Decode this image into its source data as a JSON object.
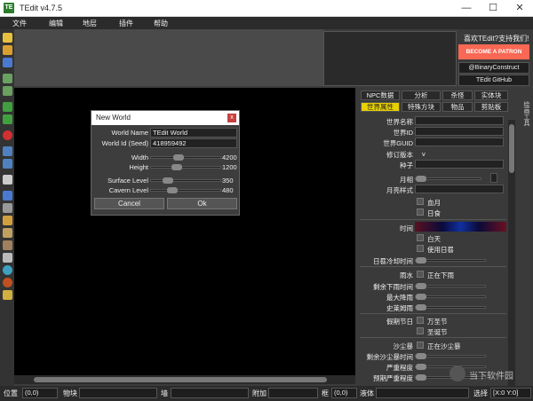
{
  "window": {
    "title": "TEdit v4.7.5",
    "app_icon": "TE",
    "minimize": "—",
    "maximize": "☐",
    "close": "✕"
  },
  "menu": [
    "文件",
    "编辑",
    "地层",
    "插件",
    "帮助"
  ],
  "support": {
    "label": "喜欢TEdit?支持我们!",
    "patron": "BECOME A PATRON",
    "twitter": "@BinaryConstruct",
    "github": "TEdit GitHub"
  },
  "dialog": {
    "title": "New World",
    "close": "x",
    "world_name_label": "World Name",
    "world_name": "TEdit World",
    "world_id_label": "World Id (Seed)",
    "world_id": "418959492",
    "width_label": "Width",
    "width": "4200",
    "width_pct": 0.38,
    "height_label": "Height",
    "height": "1200",
    "height_pct": 0.35,
    "surface_label": "Surface Level",
    "surface": "350",
    "surface_pct": 0.2,
    "cavern_label": "Cavern Level",
    "cavern": "480",
    "cavern_pct": 0.28,
    "cancel": "Cancel",
    "ok": "Ok"
  },
  "tabs_row1": [
    "NPC数据",
    "分析",
    "杀怪",
    "实体块"
  ],
  "tabs_row2": [
    "世界属性",
    "特殊方块",
    "物品",
    "剪贴板"
  ],
  "side_tab": "绘画工具",
  "props": {
    "world_name": "世界名称",
    "world_id": "世界ID",
    "world_guid": "世界GUID",
    "revision": "修订版本",
    "revision_val": "v",
    "seed": "种子",
    "moon": "月相",
    "moon_style": "月亮样式",
    "blood_moon": "血月",
    "eclipse": "日食",
    "time": "时间",
    "daytime": "白天",
    "use_sundial": "使用日晷",
    "sundial_cd": "日晷冷却时间",
    "rain": "雨水",
    "raining": "正在下雨",
    "rain_time": "剩余下雨时间",
    "max_rain": "最大降雨",
    "max_rain2": "史莱姆雨",
    "holiday": "假期节日",
    "halloween": "万圣节",
    "christmas": "圣诞节",
    "sandstorm": "沙尘暴",
    "sandstorm_on": "正在沙尘暴",
    "sandstorm_time": "剩余沙尘暴时间",
    "severity": "严重程度",
    "intended": "预期严重程度"
  },
  "status": {
    "pos_label": "位置",
    "pos": "(0,0)",
    "tile_label": "物块",
    "wall_label": "墙",
    "extra_label": "附加",
    "frame_label": "框",
    "frame": "(0,0)",
    "liquid_label": "液体",
    "select_label": "选择",
    "select": "[X:0 Y:0]"
  },
  "watermark": "当下软件园",
  "colors": {
    "accent": "#e8d000",
    "patron": "#f96854"
  }
}
